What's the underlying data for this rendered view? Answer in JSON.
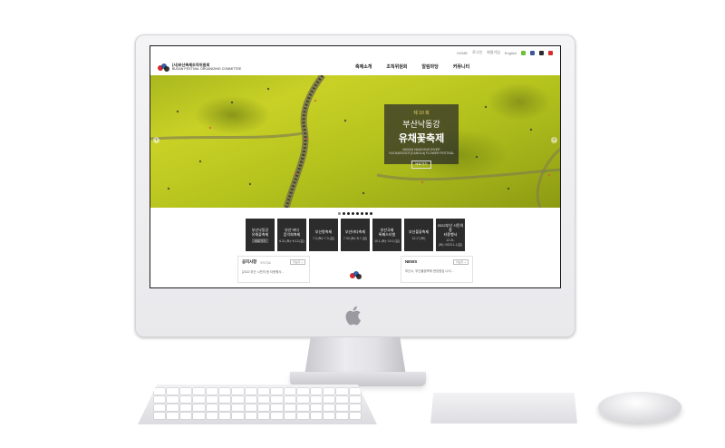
{
  "site": {
    "util_links": [
      "HOME",
      "로그인",
      "회원가입",
      "English"
    ],
    "sns": [
      {
        "name": "blog-icon",
        "color": "#6fbf3a"
      },
      {
        "name": "facebook-icon",
        "color": "#3b5998"
      },
      {
        "name": "kakao-icon",
        "color": "#2b2b2b"
      },
      {
        "name": "youtube-icon",
        "color": "#d62d2d"
      }
    ],
    "logo": {
      "name_ko": "(사)부산축제조직위원회",
      "name_en": "BUSAN FESTIVAL ORGANIZING COMMITTEE"
    },
    "gnb": [
      "축제소개",
      "조직위원회",
      "알림마당",
      "커뮤니티"
    ],
    "hero": {
      "edition": "제 10 회",
      "title_line1": "부산낙동강",
      "title_line2": "유채꽃축제",
      "title_en": "BUSAN NAKDONG RIVER YUCHAEGGOT(CANOLA) FLOWER FESTIVAL",
      "button": "바로가기",
      "prev": "‹",
      "next": "›",
      "slides": 8,
      "active_slide": 0
    },
    "festivals": [
      {
        "name": "부산낙동강\n유채꽃축제",
        "date": "바로가기",
        "selected": true
      },
      {
        "name": "부산 바다\n음악회축제",
        "date": "6.11.(토)~6.12.(일)"
      },
      {
        "name": "부산항축제",
        "date": "7.3.(토)~7.3.(일)"
      },
      {
        "name": "부산바다축제",
        "date": "7.30.(토)~8.7.(일)"
      },
      {
        "name": "부산국제\n록페스티벌",
        "date": "10.1.(토)~10.2.(일)"
      },
      {
        "name": "부산불꽃축제",
        "date": "12.17.(토)"
      },
      {
        "name": "2022부산 시민의 종\n타종행사",
        "date": "12.31.(토)~2023.1.1(일)"
      }
    ],
    "notice": {
      "title": "공지사항",
      "tab": "보도자료",
      "more": "더보기 +",
      "item": "[2022 부산 시민의 종 타종행사..."
    },
    "news": {
      "title": "NEWS",
      "more": "더보기 +",
      "item": "부산시, 부산불꽃축제 현장점검 나서..."
    }
  },
  "hardware": {
    "logo": "apple-logo"
  }
}
